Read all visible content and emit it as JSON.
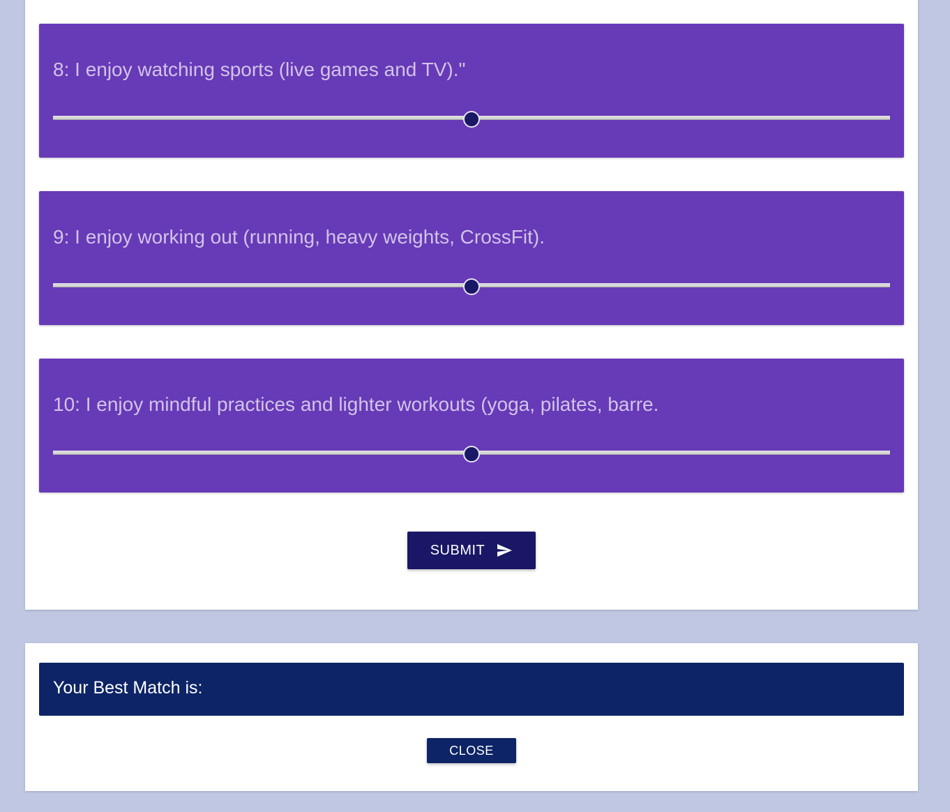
{
  "questions": [
    {
      "text": "8: I enjoy watching sports (live games and TV).\"",
      "slider_value_fraction": 0.5
    },
    {
      "text": "9: I enjoy working out (running, heavy weights, CrossFit).",
      "slider_value_fraction": 0.5
    },
    {
      "text": "10: I enjoy mindful practices and lighter workouts (yoga, pilates, barre.",
      "slider_value_fraction": 0.5
    }
  ],
  "submit": {
    "label": "SUBMIT",
    "icon": "send-icon"
  },
  "result": {
    "title": "Your Best Match is:",
    "close_label": "CLOSE"
  },
  "colors": {
    "page_background": "#c0c7e3",
    "question_card": "#673ab7",
    "question_text": "#d1c4e9",
    "primary_button": "#1a1766",
    "result_header": "#0d2466"
  }
}
